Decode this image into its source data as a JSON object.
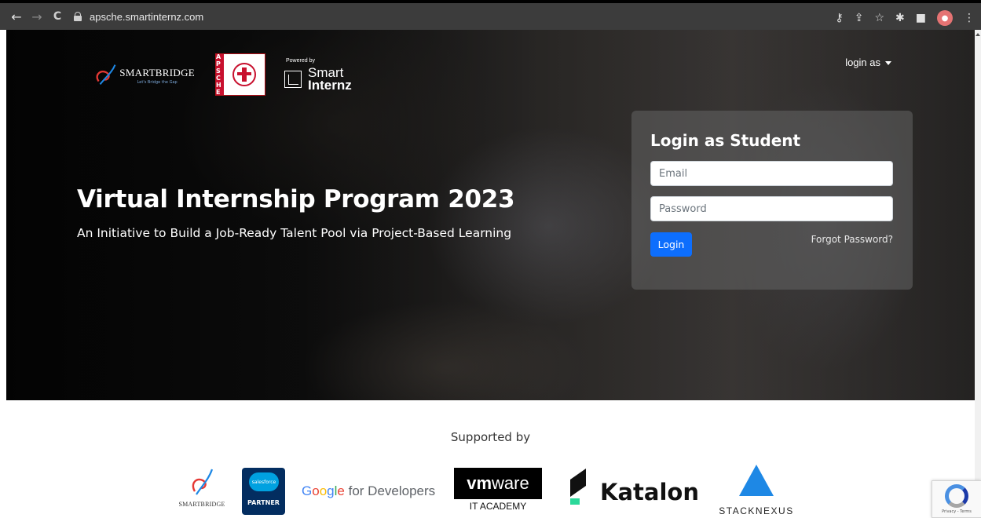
{
  "browser": {
    "url": "apsche.smartinternz.com",
    "back_icon": "←",
    "forward_icon": "→",
    "reload_icon": "C"
  },
  "header": {
    "smartbridge_name": "SMARTBRIDGE",
    "smartbridge_tagline": "Let's Bridge the Gap",
    "apsche_letters": "APSCHE",
    "powered_by": "Powered by",
    "smartinternz_line1": "Smart",
    "smartinternz_line2": "Internz",
    "login_as_label": "login as"
  },
  "hero": {
    "title": "Virtual Internship Program 2023",
    "subtitle": "An Initiative to Build a Job-Ready Talent Pool via Project-Based Learning"
  },
  "login": {
    "title": "Login as Student",
    "email_placeholder": "Email",
    "password_placeholder": "Password",
    "email_value": "",
    "password_value": "",
    "login_button": "Login",
    "forgot_password": "Forgot Password?"
  },
  "supported": {
    "heading": "Supported by",
    "partners": {
      "smartbridge": "SMARTBRIDGE",
      "salesforce_cloud": "salesforce",
      "salesforce_partner": "PARTNER",
      "google_g": "G",
      "google_o1": "o",
      "google_o2": "o",
      "google_g2": "g",
      "google_l": "l",
      "google_e": "e",
      "google_rest": " for Developers",
      "vmware_vm": "vm",
      "vmware_ware": "ware",
      "vmware_academy": "IT ACADEMY",
      "katalon": "Katalon",
      "stacknexus": "STACKNEXUS"
    }
  },
  "recaptcha": {
    "text": "Privacy - Terms"
  },
  "colors": {
    "primary_button": "#0d6efd",
    "brand_red": "#c8102e",
    "katalon_green": "#2bd99a",
    "stacknexus_blue": "#1e88e5"
  }
}
